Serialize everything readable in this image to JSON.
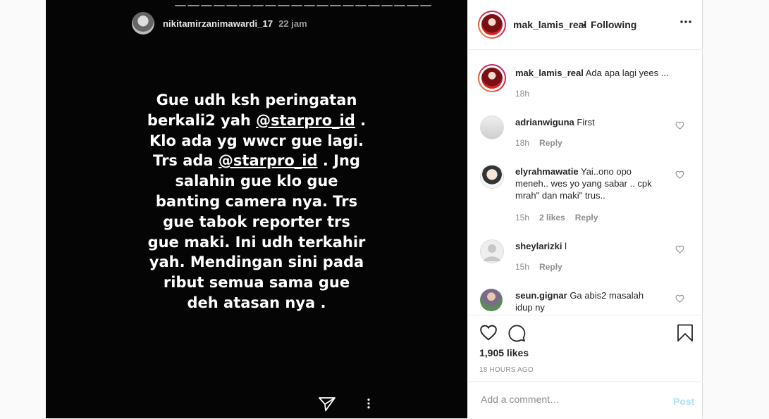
{
  "story": {
    "username": "nikitamirzanimawardi_17",
    "time": "22 jam",
    "lines": [
      "Gue udh ksh peringatan",
      "berkali2 yah @starpro_id .",
      "Klo ada yg wwcr gue lagi.",
      "Trs ada @starpro_id . Jng",
      "salahin gue klo gue",
      "banting camera nya. Trs",
      "gue tabok reporter trs",
      "gue maki. Ini udh terkahir",
      "yah. Mendingan sini pada",
      "ribut semua sama gue",
      "deh atasan nya ."
    ]
  },
  "post": {
    "username": "mak_lamis_real",
    "dot": "•",
    "follow_state": "Following",
    "caption_user": "mak_lamis_real",
    "caption_text": "Ada apa lagi yees ...",
    "caption_time": "18h",
    "likes": "1,905 likes",
    "posted": "18 HOURS AGO"
  },
  "comments": [
    {
      "user": "adrianwiguna",
      "text": "First",
      "time": "18h",
      "likes": "",
      "reply": "Reply"
    },
    {
      "user": "elyrahmawatie",
      "text": "Yai..ono opo meneh.. wes yo yang sabar .. cpk mrah\" dan maki\" trus..",
      "time": "15h",
      "likes": "2 likes",
      "reply": "Reply"
    },
    {
      "user": "sheylarizki",
      "text": "l",
      "time": "15h",
      "likes": "",
      "reply": "Reply"
    },
    {
      "user": "seun.gignar",
      "text": "Ga abis2 masalah idup ny",
      "time": "",
      "likes": "",
      "reply": ""
    }
  ],
  "add_comment": {
    "placeholder": "Add a comment…",
    "post_label": "Post"
  },
  "icons": {
    "more": "more-horiz-icon",
    "like": "heart-icon",
    "comment": "comment-icon",
    "save": "bookmark-icon",
    "send": "send-icon"
  },
  "colors": {
    "post_button_disabled": "#b2dffc",
    "meta_gray": "#8e8e8e",
    "story_bg": "#050505"
  }
}
